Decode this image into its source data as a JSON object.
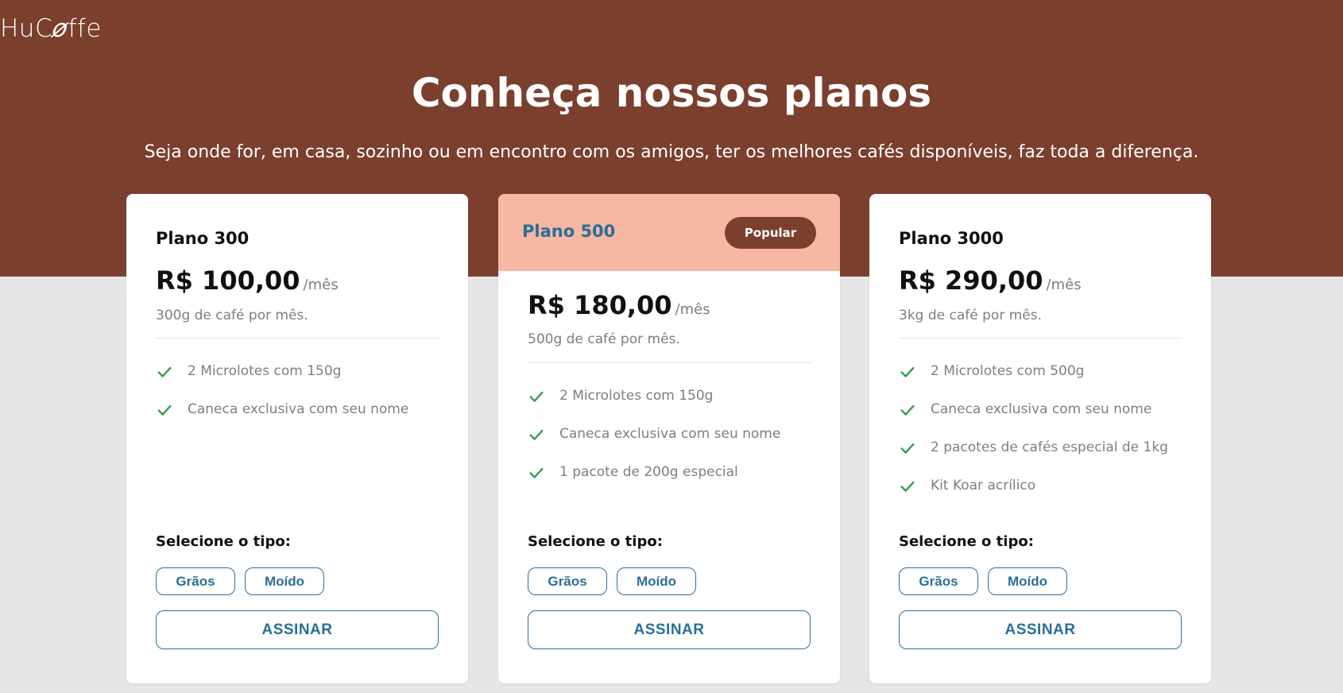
{
  "brand": {
    "logo_prefix": "HuC",
    "logo_bean": "ø",
    "logo_suffix": "ffe"
  },
  "hero": {
    "title": "Conheça nossos planos",
    "subtitle": "Seja onde for, em casa, sozinho ou em encontro com os amigos, ter os melhores cafés disponíveis, faz toda a diferença."
  },
  "colors": {
    "hero_bg": "#7b3f2e",
    "accent": "#2a6f97",
    "popular_header": "#f7b7a2",
    "check": "#2e9e4f"
  },
  "common": {
    "per": "/mês",
    "select_label": "Selecione o tipo:",
    "type_grain": "Grãos",
    "type_ground": "Moído",
    "subscribe": "ASSINAR"
  },
  "plans": [
    {
      "name": "Plano 300",
      "price": "R$ 100,00",
      "desc": "300g de café por mês.",
      "features": [
        "2 Microlotes com 150g",
        "Caneca exclusiva com seu nome"
      ]
    },
    {
      "name": "Plano 500",
      "badge": "Popular",
      "price": "R$ 180,00",
      "desc": "500g de café por mês.",
      "features": [
        "2 Microlotes com 150g",
        "Caneca exclusiva com seu nome",
        "1 pacote de 200g especial"
      ]
    },
    {
      "name": "Plano 3000",
      "price": "R$ 290,00",
      "desc": "3kg de café por mês.",
      "features": [
        "2 Microlotes com 500g",
        "Caneca exclusiva com seu nome",
        "2 pacotes de cafés especial de 1kg",
        "Kit Koar acrílico"
      ]
    }
  ]
}
